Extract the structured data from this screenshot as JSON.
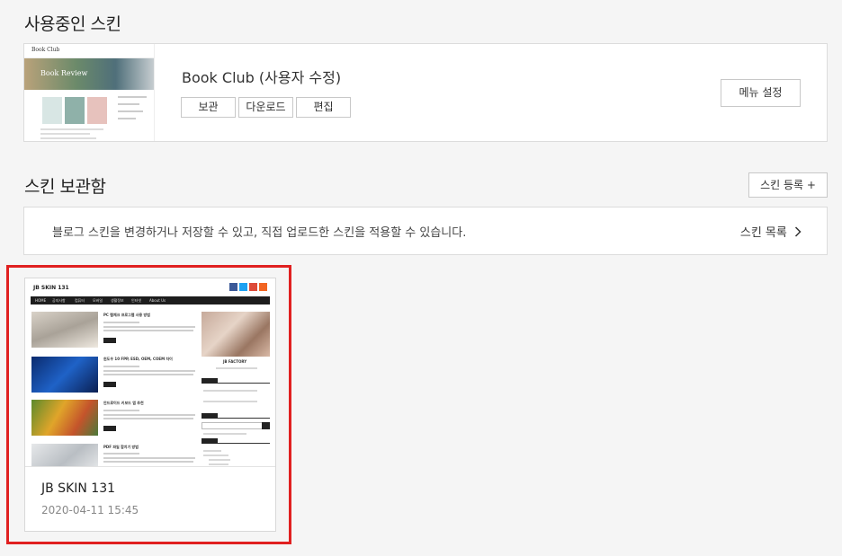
{
  "sections": {
    "in_use_title": "사용중인 스킨",
    "store_title": "스킨 보관함"
  },
  "current_skin": {
    "thumbnail": {
      "logo": "Book Club",
      "hero_text": "Book Review"
    },
    "name": "Book Club (사용자 수정)",
    "buttons": {
      "keep": "보관",
      "download": "다운로드",
      "edit": "편집",
      "menu_settings": "메뉴 설정"
    }
  },
  "store": {
    "register_label": "스킨 등록 +",
    "info_text": "블로그 스킨을 변경하거나 저장할 수 있고, 직접 업로드한 스킨을 적용할 수 있습니다.",
    "list_link": "스킨 목록",
    "list_link_icon": "chevron-right-icon",
    "skins": [
      {
        "name": "JB SKIN 131",
        "date": "2020-04-11 15:45",
        "thumbnail": {
          "title": "JB SKIN 131",
          "nav": [
            "HOME",
            "공지사항",
            "컴퓨터",
            "모바일",
            "생활정보",
            "인터넷",
            "About Us"
          ],
          "posts": [
            "PC 램체크 프로그램 사용 방법",
            "윈도우 10 FPP, ESD, OEM, COEM 차이",
            "안드로이드 키보드 앱 추천",
            "PDF 파일 합치기 방법"
          ],
          "profile": "JB FACTORY",
          "social_colors": [
            "#3b5998",
            "#1da1f2",
            "#dd4b39",
            "#f26522"
          ]
        }
      }
    ]
  }
}
